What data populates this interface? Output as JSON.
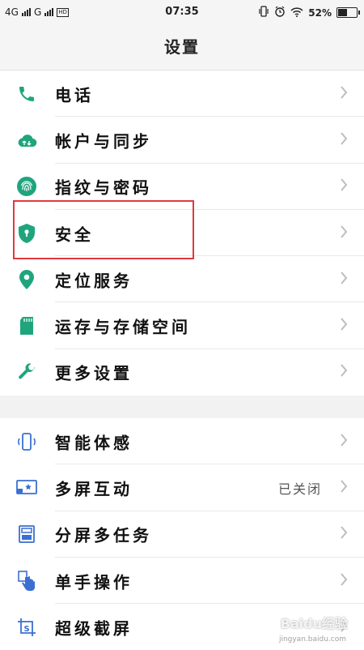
{
  "status": {
    "net1": "4G",
    "net2": "G",
    "hd": "HD",
    "time": "07:35",
    "battery": "52%",
    "battery_level": 0.52
  },
  "title": "设置",
  "group1": [
    {
      "label": "电话",
      "icon": "phone-icon"
    },
    {
      "label": "帐户与同步",
      "icon": "cloud-sync-icon"
    },
    {
      "label": "指纹与密码",
      "icon": "fingerprint-icon"
    },
    {
      "label": "安全",
      "icon": "shield-icon"
    },
    {
      "label": "定位服务",
      "icon": "location-pin-icon"
    },
    {
      "label": "运存与存储空间",
      "icon": "sd-card-icon"
    },
    {
      "label": "更多设置",
      "icon": "wrench-icon"
    }
  ],
  "group2": [
    {
      "label": "智能体感",
      "icon": "phone-motion-icon"
    },
    {
      "label": "多屏互动",
      "icon": "screen-cast-icon",
      "value": "已关闭"
    },
    {
      "label": "分屏多任务",
      "icon": "split-screen-icon"
    },
    {
      "label": "单手操作",
      "icon": "hand-icon"
    },
    {
      "label": "超级截屏",
      "icon": "screenshot-icon"
    }
  ],
  "colors": {
    "accent_green": "#1fa57c",
    "accent_blue": "#3b6fd1",
    "highlight_red": "#e0393e"
  },
  "watermark": "Baidu经验",
  "watermark_sub": "jingyan.baidu.com"
}
